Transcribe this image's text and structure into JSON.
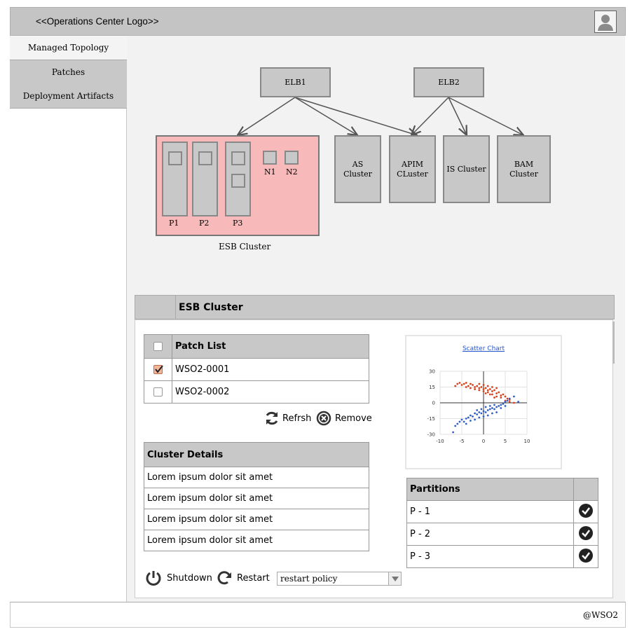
{
  "header": {
    "logo": "<<Operations Center Logo>>"
  },
  "sidebar": {
    "items": [
      {
        "label": "Managed Topology",
        "active": true
      },
      {
        "label": "Patches",
        "active": false
      },
      {
        "label": "Deployment Artifacts",
        "active": false
      }
    ]
  },
  "topology": {
    "elb1": "ELB1",
    "elb2": "ELB2",
    "esb_caption": "ESB Cluster",
    "p1": "P1",
    "p2": "P2",
    "p3": "P3",
    "n1": "N1",
    "n2": "N2",
    "as_line1": "AS",
    "as_line2": "Cluster",
    "apim_line1": "APIM",
    "apim_line2": "CLuster",
    "is_label": "IS Cluster",
    "bam_line1": "BAM",
    "bam_line2": "Cluster"
  },
  "panel": {
    "title": "ESB Cluster"
  },
  "patches": {
    "header": "Patch List",
    "rows": [
      {
        "id": "WSO2-0001",
        "checked": true
      },
      {
        "id": "WSO2-0002",
        "checked": false
      }
    ],
    "refresh_label": "Refrsh",
    "remove_label": "Remove"
  },
  "cluster_details": {
    "header": "Cluster Details",
    "rows": [
      "Lorem ipsum dolor sit amet",
      "Lorem ipsum dolor sit amet",
      "Lorem ipsum dolor sit amet",
      "Lorem ipsum dolor sit amet"
    ]
  },
  "chart": {
    "title": "Scatter Chart"
  },
  "chart_data": {
    "type": "scatter",
    "title": "Scatter Chart",
    "xlim": [
      -10,
      10
    ],
    "ylim": [
      -30,
      30
    ],
    "xticks": [
      -10,
      -5,
      0,
      5,
      10
    ],
    "yticks": [
      30,
      15,
      0,
      -15,
      -30
    ],
    "grid": true,
    "series": [
      {
        "color": "#d6401a",
        "points": [
          [
            -6,
            18
          ],
          [
            -5.5,
            19
          ],
          [
            -5,
            17
          ],
          [
            -4.5,
            18
          ],
          [
            -4,
            19
          ],
          [
            -3.5,
            16
          ],
          [
            -3,
            18
          ],
          [
            -2.5,
            17
          ],
          [
            -2,
            15
          ],
          [
            -1.5,
            16
          ],
          [
            -1,
            14
          ],
          [
            -0.5,
            15
          ],
          [
            0,
            13
          ],
          [
            0.5,
            14
          ],
          [
            1,
            12
          ],
          [
            1.5,
            13
          ],
          [
            2,
            11
          ],
          [
            2.5,
            12
          ],
          [
            3,
            9
          ],
          [
            3.5,
            10
          ],
          [
            4,
            7
          ],
          [
            4.5,
            8
          ],
          [
            5,
            6
          ],
          [
            5.5,
            4
          ],
          [
            6,
            3
          ],
          [
            -1,
            18
          ],
          [
            0,
            17
          ],
          [
            1,
            16
          ],
          [
            2,
            15
          ],
          [
            3,
            14
          ],
          [
            -2,
            13
          ],
          [
            -1,
            12
          ],
          [
            0,
            11
          ],
          [
            1,
            10
          ],
          [
            2,
            8
          ],
          [
            3,
            6
          ],
          [
            4,
            5
          ],
          [
            5,
            2
          ],
          [
            6,
            1
          ],
          [
            7,
            0
          ],
          [
            -6.5,
            16
          ],
          [
            -4,
            15
          ],
          [
            -3,
            14
          ],
          [
            0.5,
            9
          ],
          [
            1.5,
            8
          ],
          [
            2.5,
            5
          ]
        ]
      },
      {
        "color": "#2f5fc4",
        "points": [
          [
            -7,
            -28
          ],
          [
            -6.5,
            -22
          ],
          [
            -6,
            -20
          ],
          [
            -5.5,
            -18
          ],
          [
            -5,
            -16
          ],
          [
            -4.5,
            -18
          ],
          [
            -4,
            -15
          ],
          [
            -3.5,
            -14
          ],
          [
            -3,
            -12
          ],
          [
            -2.5,
            -13
          ],
          [
            -2,
            -10
          ],
          [
            -1.5,
            -11
          ],
          [
            -1,
            -9
          ],
          [
            -0.5,
            -10
          ],
          [
            0,
            -8
          ],
          [
            0.5,
            -9
          ],
          [
            1,
            -7
          ],
          [
            1.5,
            -6
          ],
          [
            2,
            -5
          ],
          [
            2.5,
            -6
          ],
          [
            3,
            -4
          ],
          [
            3.5,
            -3
          ],
          [
            4,
            -2
          ],
          [
            4.5,
            -1
          ],
          [
            5,
            1
          ],
          [
            5.5,
            2
          ],
          [
            6,
            4
          ],
          [
            7,
            6
          ],
          [
            8,
            1
          ],
          [
            -1,
            -14
          ],
          [
            0,
            -13
          ],
          [
            1,
            -12
          ],
          [
            2,
            -10
          ],
          [
            3,
            -9
          ],
          [
            -2,
            -16
          ],
          [
            -3,
            -17
          ],
          [
            -4,
            -20
          ],
          [
            0.5,
            -4
          ],
          [
            1.5,
            -3
          ],
          [
            2.5,
            -2
          ],
          [
            -0.5,
            -6
          ],
          [
            -1.5,
            -7
          ],
          [
            4,
            -5
          ],
          [
            5,
            -3
          ]
        ]
      }
    ]
  },
  "partitions": {
    "header": "Partitions",
    "rows": [
      "P - 1",
      "P - 2",
      "P - 3"
    ]
  },
  "actions": {
    "shutdown": "Shutdown",
    "restart": "Restart",
    "policy": "restart policy"
  },
  "footer": {
    "copyright": "@WSO2"
  }
}
